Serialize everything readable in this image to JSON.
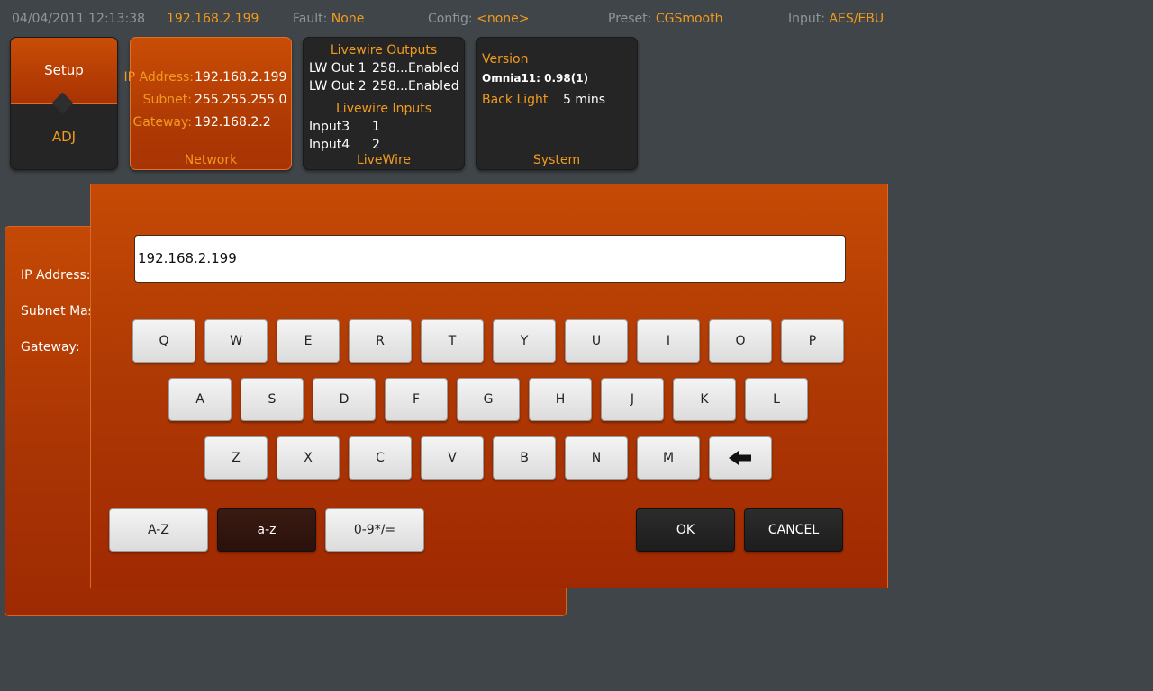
{
  "status": {
    "datetime": "04/04/2011 12:13:38",
    "ip": "192.168.2.199",
    "fault_label": "Fault:",
    "fault_value": "None",
    "config_label": "Config:",
    "config_value": "<none>",
    "preset_label": "Preset:",
    "preset_value": "CGSmooth",
    "input_label": "Input:",
    "input_value": "AES/EBU"
  },
  "setup_tile": {
    "top_label": "Setup",
    "bottom_label": "ADJ"
  },
  "network": {
    "ip_label": "IP Address:",
    "ip_value": "192.168.2.199",
    "subnet_label": "Subnet:",
    "subnet_value": "255.255.255.0",
    "gateway_label": "Gateway:",
    "gateway_value": "192.168.2.2",
    "title": "Network"
  },
  "livewire": {
    "outputs_title": "Livewire Outputs",
    "outputs": [
      {
        "name": "LW Out 1",
        "channel": "258...",
        "state": "Enabled"
      },
      {
        "name": "LW Out 2",
        "channel": "258...",
        "state": "Enabled"
      }
    ],
    "inputs_title": "Livewire Inputs",
    "inputs": [
      {
        "name": "Input3",
        "value": "1"
      },
      {
        "name": "Input4",
        "value": "2"
      }
    ],
    "title": "LiveWire"
  },
  "system": {
    "version_label": "Version",
    "version_value": "Omnia11: 0.98(1)",
    "backlight_label": "Back Light",
    "backlight_value": "5 mins",
    "title": "System"
  },
  "background_panel": {
    "ip_label": "IP Address:",
    "subnet_label": "Subnet Mask:",
    "gateway_label": "Gateway:"
  },
  "keyboard": {
    "entry_value": "192.168.2.199",
    "row1": [
      "Q",
      "W",
      "E",
      "R",
      "T",
      "Y",
      "U",
      "I",
      "O",
      "P"
    ],
    "row2": [
      "A",
      "S",
      "D",
      "F",
      "G",
      "H",
      "J",
      "K",
      "L"
    ],
    "row3": [
      "Z",
      "X",
      "C",
      "V",
      "B",
      "N",
      "M"
    ],
    "backspace_icon": "left-arrow-icon",
    "mode_upper": "A-Z",
    "mode_lower": "a-z",
    "mode_symbols": "0-9*/=",
    "ok": "OK",
    "cancel": "CANCEL"
  }
}
